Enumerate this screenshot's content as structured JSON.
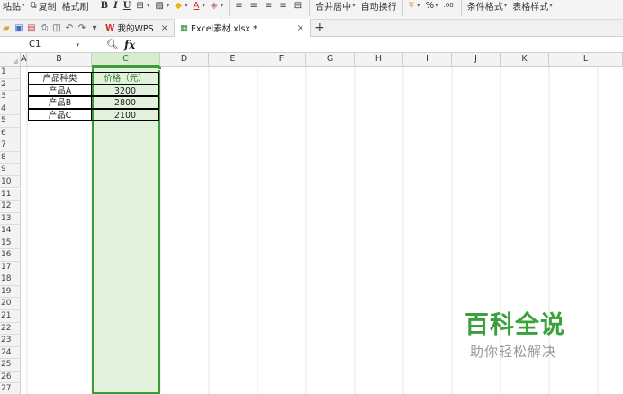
{
  "ribbon": {
    "paste": "粘贴",
    "copy": "复制",
    "format_painter": "格式刷",
    "bold": "B",
    "italic": "I",
    "underline": "U",
    "merge_center": "合并居中",
    "wrap_text": "自动换行",
    "percent": "%",
    "cond_format": "条件格式",
    "table_style": "表格样式"
  },
  "tabs": {
    "wps_home": "我的WPS",
    "doc": "Excel素材.xlsx *",
    "close": "×",
    "add": "+"
  },
  "formula_bar": {
    "name_box": "C1",
    "fx": "fx",
    "formula": ""
  },
  "columns": [
    "A",
    "B",
    "C",
    "D",
    "E",
    "F",
    "G",
    "H",
    "I",
    "J",
    "K",
    "L"
  ],
  "rows": [
    "1",
    "2",
    "3",
    "4",
    "5",
    "6",
    "7",
    "8",
    "9",
    "10",
    "11",
    "12",
    "13",
    "14",
    "15",
    "16",
    "17",
    "18",
    "19",
    "20",
    "21",
    "22",
    "23",
    "24",
    "25",
    "26",
    "27"
  ],
  "table": {
    "header": [
      "产品种类",
      "价格（元）"
    ],
    "rows": [
      [
        "产品A",
        "3200"
      ],
      [
        "产品B",
        "2800"
      ],
      [
        "产品C",
        "2100"
      ]
    ]
  },
  "watermark": {
    "title": "百科全说",
    "subtitle": "助你轻松解决"
  },
  "colors": {
    "selection": "#3a9c3a",
    "selection_fill": "#e3f2dd",
    "watermark": "#3aa13a"
  }
}
